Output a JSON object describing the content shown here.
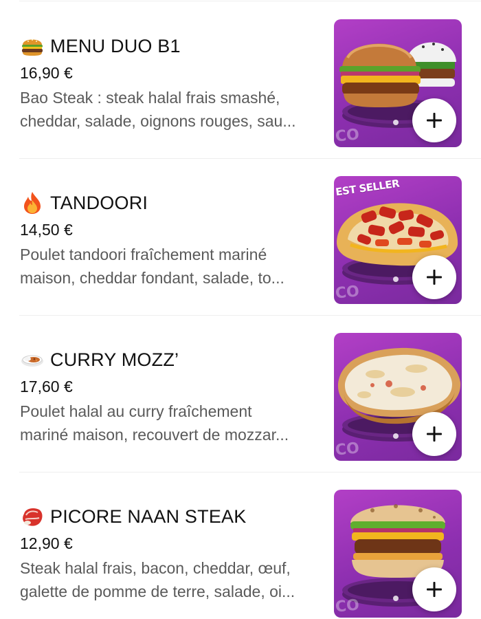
{
  "menu": {
    "items": [
      {
        "emoji": "burger-icon",
        "title": "MENU DUO B1",
        "price": "16,90 €",
        "desc_line1": "Bao Steak : steak halal frais smashé,",
        "desc_line2": "cheddar, salade, oignons rouges, sau...",
        "image": "burger-duo-image"
      },
      {
        "emoji": "fire-icon",
        "title": "TANDOORI",
        "price": "14,50 €",
        "desc_line1": "Poulet tandoori fraîchement mariné",
        "desc_line2": "maison, cheddar fondant, salade, to...",
        "image": "tandoori-naan-image",
        "badge": "EST SELLER"
      },
      {
        "emoji": "curry-icon",
        "title": "CURRY MOZZ’",
        "price": "17,60 €",
        "desc_line1": "Poulet halal au curry fraîchement",
        "desc_line2": "mariné maison, recouvert de mozzar...",
        "image": "curry-mozz-naan-image"
      },
      {
        "emoji": "steak-icon",
        "title": "PICORE NAAN STEAK",
        "price": "12,90 €",
        "desc_line1": "Steak halal frais, bacon, cheddar, œuf,",
        "desc_line2": "galette de pomme de terre, salade, oi...",
        "image": "naan-steak-burger-image"
      }
    ],
    "brand_watermark": "CO",
    "add_icon": "plus-icon"
  },
  "colors": {
    "thumb_purple": "#9b35b9",
    "title_text": "#111111",
    "desc_text": "#5a5a5a",
    "divider": "#eeeeee"
  }
}
